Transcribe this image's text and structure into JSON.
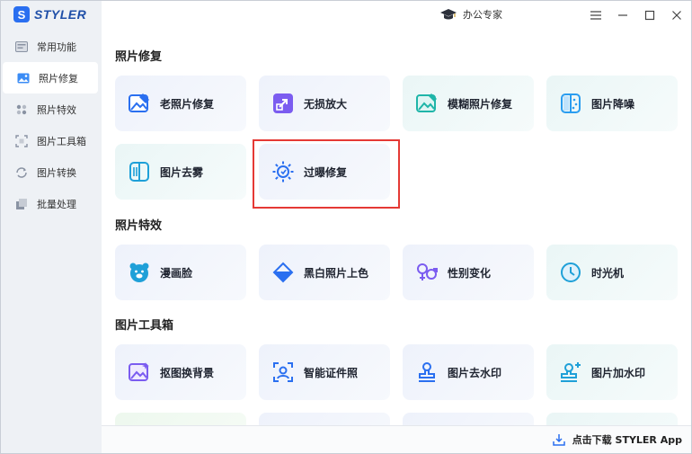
{
  "app": {
    "logo_letter": "S",
    "logo_text": "STYLER",
    "brand_tag": "办公专家"
  },
  "sidebar": {
    "items": [
      {
        "label": "常用功能",
        "icon": "grid-icon"
      },
      {
        "label": "照片修复",
        "icon": "image-icon"
      },
      {
        "label": "照片特效",
        "icon": "sparkle-icon"
      },
      {
        "label": "图片工具箱",
        "icon": "crop-icon"
      },
      {
        "label": "图片转换",
        "icon": "convert-icon"
      },
      {
        "label": "批量处理",
        "icon": "stack-icon"
      }
    ],
    "active_index": 1
  },
  "sections": [
    {
      "title": "照片修复",
      "cards": [
        "老照片修复",
        "无损放大",
        "模糊照片修复",
        "图片降噪",
        "图片去雾",
        "过曝修复"
      ]
    },
    {
      "title": "照片特效",
      "cards": [
        "漫画脸",
        "黑白照片上色",
        "性别变化",
        "时光机"
      ]
    },
    {
      "title": "图片工具箱",
      "cards": [
        "抠图换背景",
        "智能证件照",
        "图片去水印",
        "图片加水印"
      ]
    }
  ],
  "footer": {
    "download_label": "点击下载 STYLER App"
  },
  "colors": {
    "accent": "#2a6ff0",
    "highlight": "#e53935"
  }
}
